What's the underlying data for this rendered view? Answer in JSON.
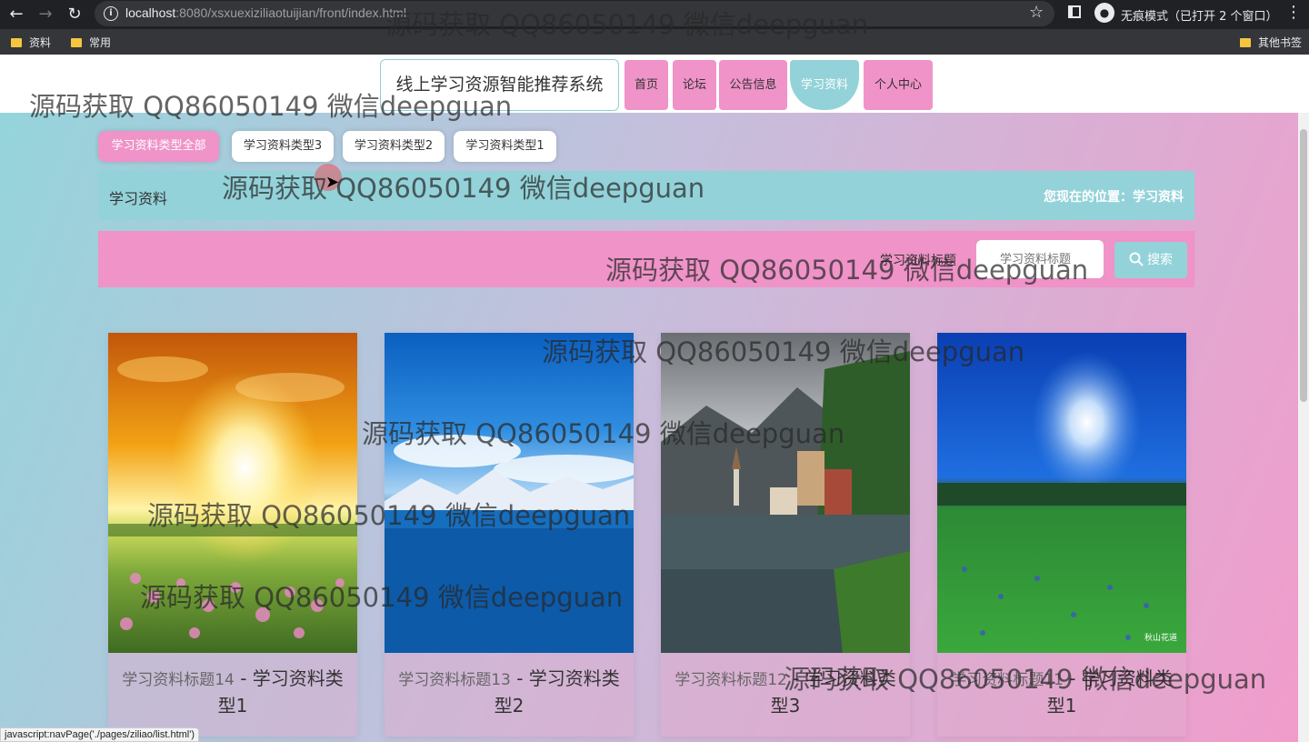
{
  "browser": {
    "url_host": "localhost",
    "url_path": ":8080/xsxuexiziliaotuijian/front/index.html",
    "incognito_label": "无痕模式（已打开 2 个窗口）",
    "bookmarks": [
      "资料",
      "常用"
    ],
    "other_bookmarks": "其他书签"
  },
  "header": {
    "site_title": "线上学习资源智能推荐系统",
    "nav": [
      "首页",
      "论坛",
      "公告信息",
      "学习资料",
      "个人中心"
    ],
    "active_nav": "学习资料"
  },
  "categories": {
    "tabs": [
      "学习资料类型全部",
      "学习资料类型3",
      "学习资料类型2",
      "学习资料类型1"
    ],
    "active": "学习资料类型全部"
  },
  "breadcrumb": {
    "title": "学习资料",
    "location": "您现在的位置：学习资料"
  },
  "search": {
    "label": "学习资料标题",
    "placeholder": "学习资料标题",
    "button": "搜索"
  },
  "cards": [
    {
      "title": "学习资料标题14",
      "type": "学习资料类型1"
    },
    {
      "title": "学习资料标题13",
      "type": "学习资料类型2"
    },
    {
      "title": "学习资料标题12",
      "type": "学习资料类型3"
    },
    {
      "title": "学习资料标题11",
      "type": "学习资料类型1"
    }
  ],
  "status_bar": "javascript:navPage('./pages/ziliao/list.html')",
  "watermark_text": "源码获取 QQ86050149 微信deepguan",
  "image_caption": "秋山花道",
  "colors": {
    "teal": "#93d2d9",
    "pink": "#ef93c8"
  }
}
